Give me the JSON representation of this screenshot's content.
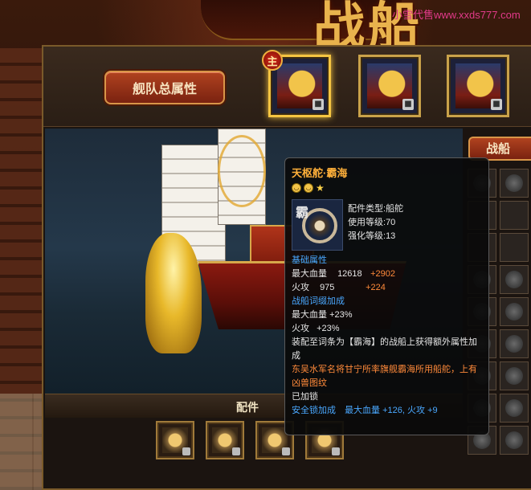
{
  "header": {
    "title": "战船",
    "watermark": "小雪代售www.xxds777.com"
  },
  "fleet_button": {
    "label": "舰队总属性"
  },
  "ship_slots": [
    {
      "badge": "主",
      "active": true,
      "locked": true
    },
    {
      "active": false,
      "locked": true
    },
    {
      "active": false,
      "locked": true
    }
  ],
  "side_panel": {
    "tab_label": "战船"
  },
  "parts": {
    "label": "配件",
    "slots": [
      {
        "name": "part-slot-1",
        "locked": true
      },
      {
        "name": "part-slot-2",
        "locked": true
      },
      {
        "name": "part-slot-3",
        "locked": true
      },
      {
        "name": "part-slot-4",
        "locked": true
      }
    ]
  },
  "tooltip": {
    "name": "天枢舵·霸海",
    "stars": [
      "face",
      "face",
      "star"
    ],
    "icon_char": "霸",
    "part_type_label": "配件类型:",
    "part_type_value": "船舵",
    "use_level_label": "使用等级:",
    "use_level_value": "70",
    "enhance_level_label": "强化等级:",
    "enhance_level_value": "13",
    "base_attr_header": "基础属性",
    "base_attrs": [
      {
        "label": "最大血量",
        "value": "12618",
        "bonus": "+2902"
      },
      {
        "label": "火攻",
        "value": "975",
        "bonus": "+224"
      }
    ],
    "affix_header": "战船词缀加成",
    "affix_attrs": [
      {
        "label": "最大血量",
        "value": "+23%"
      },
      {
        "label": "火攻",
        "value": "+23%"
      }
    ],
    "equip_note": "装配至词条为【霸海】的战船上获得额外属性加成",
    "flavor_text": "东吴水军名将甘宁所率旗舰霸海所用船舵，上有凶兽图纹",
    "lock_status": "已加锁",
    "safe_lock_label": "安全锁加成",
    "safe_lock_value": "最大血量 +126, 火攻 +9"
  },
  "colors": {
    "title_gold": "#e9b34d",
    "tooltip_title": "#ffb03a",
    "attr_blue": "#4aa8ff",
    "bonus_orange": "#ff8a3a",
    "watermark": "#e23a8a"
  }
}
